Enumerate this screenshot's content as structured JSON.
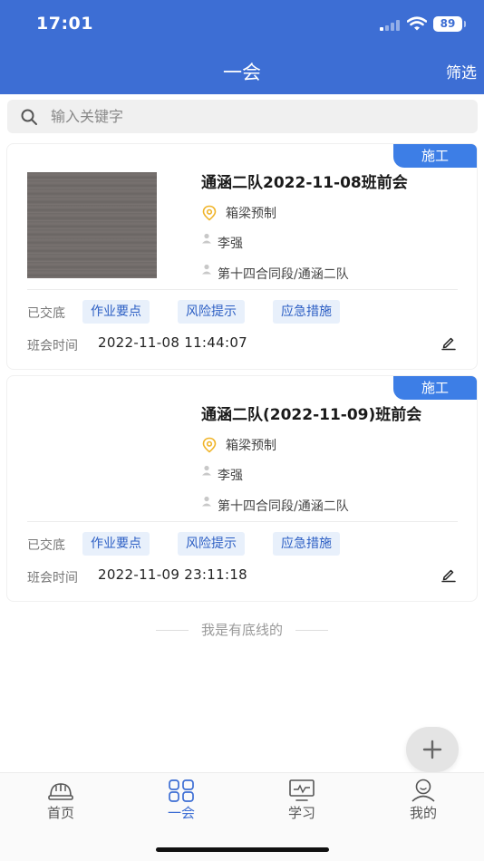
{
  "status_bar": {
    "time": "17:01",
    "battery": "89"
  },
  "header": {
    "title": "一会",
    "filter_label": "筛选"
  },
  "search": {
    "placeholder": "输入关键字"
  },
  "cards": [
    {
      "badge": "施工",
      "title": "通涵二队2022-11-08班前会",
      "location": "箱梁预制",
      "person": "李强",
      "team": "第十四合同段/通涵二队",
      "tags_label": "已交底",
      "tags": [
        "作业要点",
        "风险提示",
        "应急措施"
      ],
      "time_label": "班会时间",
      "time_value": "2022-11-08 11:44:07"
    },
    {
      "badge": "施工",
      "title": "通涵二队(2022-11-09)班前会",
      "location": "箱梁预制",
      "person": "李强",
      "team": "第十四合同段/通涵二队",
      "tags_label": "已交底",
      "tags": [
        "作业要点",
        "风险提示",
        "应急措施"
      ],
      "time_label": "班会时间",
      "time_value": "2022-11-09 23:11:18"
    }
  ],
  "end_text": "我是有底线的",
  "tabbar": {
    "items": [
      {
        "label": "首页",
        "icon": "helmet-icon"
      },
      {
        "label": "一会",
        "icon": "grid-icon",
        "active": true
      },
      {
        "label": "学习",
        "icon": "monitor-icon"
      },
      {
        "label": "我的",
        "icon": "user-icon"
      }
    ]
  },
  "colors": {
    "primary": "#3d6ed4",
    "badge": "#3d7ee6",
    "tag_bg": "#e8f0fb",
    "tag_text": "#2d5fc4",
    "location_icon": "#f0b429"
  }
}
